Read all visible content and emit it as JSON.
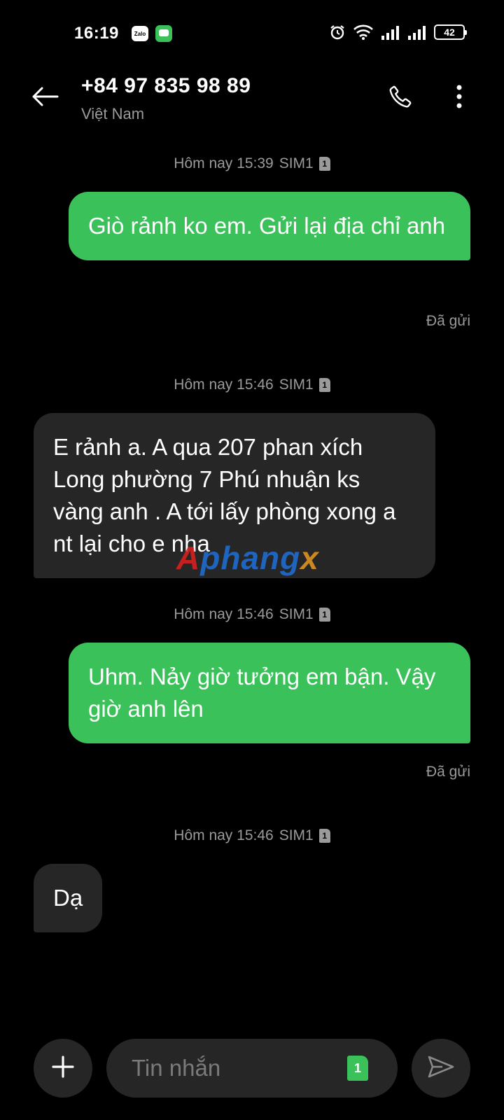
{
  "status_bar": {
    "time": "16:19",
    "zalo_label": "Zalo",
    "battery": "42",
    "icons": [
      "zalo-icon",
      "messages-icon",
      "alarm-icon",
      "wifi-icon",
      "signal-icon",
      "signal-icon",
      "battery-icon"
    ]
  },
  "header": {
    "contact_number": "+84 97 835 98 89",
    "contact_country": "Việt Nam",
    "icons": [
      "back-arrow-icon",
      "phone-icon",
      "more-vert-icon"
    ]
  },
  "messages": [
    {
      "timestamp": "Hôm nay 15:39",
      "sim": "SIM1",
      "sim_index": "1",
      "direction": "sent",
      "text": "Giò rảnh ko em. Gửi lại địa chỉ anh",
      "status": "Đã gửi"
    },
    {
      "timestamp": "Hôm nay 15:46",
      "sim": "SIM1",
      "sim_index": "1",
      "direction": "received",
      "text": "E rảnh a. A qua 207 phan xích Long phường 7 Phú nhuận ks vàng anh . A tới lấy phòng xong a nt lại cho e nha"
    },
    {
      "timestamp": "Hôm nay 15:46",
      "sim": "SIM1",
      "sim_index": "1",
      "direction": "sent",
      "text": "Uhm. Nảy giờ tưởng em bận. Vậy giờ anh lên",
      "status": "Đã gửi"
    },
    {
      "timestamp": "Hôm nay 15:46",
      "sim": "SIM1",
      "sim_index": "1",
      "direction": "received",
      "text": "Dạ"
    }
  ],
  "watermark": {
    "a": "A",
    "phang": "phang",
    "x": "x"
  },
  "composer": {
    "placeholder": "Tin nhắn",
    "value": "",
    "sim_badge": "1",
    "icons": [
      "plus-icon",
      "send-icon"
    ]
  },
  "colors": {
    "background": "#000000",
    "sent_bubble": "#3bc15a",
    "received_bubble": "#262626",
    "muted_text": "#9a9a9a"
  }
}
